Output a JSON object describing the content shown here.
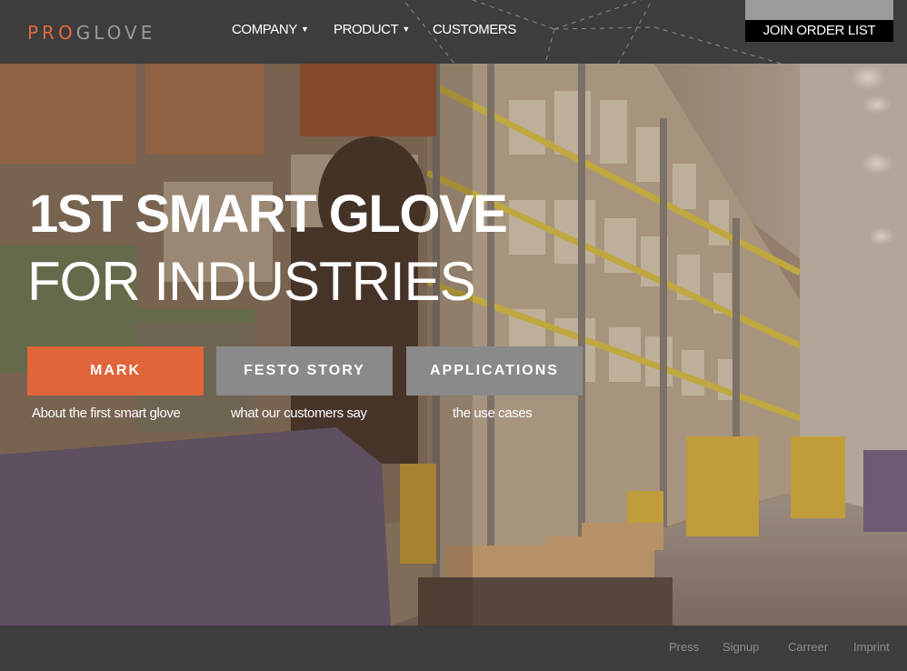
{
  "brand": {
    "logo_pro": "PRO",
    "logo_glove": "GLOVE"
  },
  "nav": {
    "items": [
      {
        "label": "COMPANY",
        "has_dropdown": true
      },
      {
        "label": "PRODUCT",
        "has_dropdown": true
      },
      {
        "label": "CUSTOMERS",
        "has_dropdown": false
      }
    ],
    "caret": "▼",
    "join_label": "JOIN ORDER LIST"
  },
  "hero": {
    "headline_line1": "1ST SMART GLOVE",
    "headline_line2": "FOR INDUSTRIES",
    "buttons": [
      {
        "label": "MARK",
        "caption": "About the first smart glove"
      },
      {
        "label": "FESTO STORY",
        "caption": "what our customers say"
      },
      {
        "label": "APPLICATIONS",
        "caption": "the use cases"
      }
    ]
  },
  "footer": {
    "links": [
      "Press",
      "Signup",
      "Carreer",
      "Imprint"
    ]
  },
  "colors": {
    "accent": "#e0653a",
    "header_bg": "#3d3d3d",
    "secondary_button": "#8a8a8a"
  }
}
